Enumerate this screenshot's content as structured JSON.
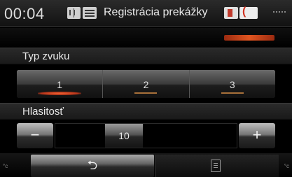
{
  "statusbar": {
    "time": "00:04",
    "title": "Registrácia prekážky"
  },
  "sound_type": {
    "label": "Typ zvuku",
    "options": [
      {
        "label": "1",
        "active": true
      },
      {
        "label": "2",
        "active": false
      },
      {
        "label": "3",
        "active": false
      }
    ]
  },
  "volume": {
    "label": "Hlasitosť",
    "minus_label": "−",
    "plus_label": "+",
    "value": "10"
  },
  "bottom_bar": {
    "back_label": "⮌",
    "corner_left": "°c",
    "corner_right": "°c"
  },
  "colors": {
    "accent": "#e05520",
    "background": "#000000"
  },
  "icons": [
    "book-icon",
    "signal-icon",
    "card-icon",
    "phone-icon",
    "signal-dots-icon",
    "back-arrow-icon",
    "menu-icon"
  ]
}
